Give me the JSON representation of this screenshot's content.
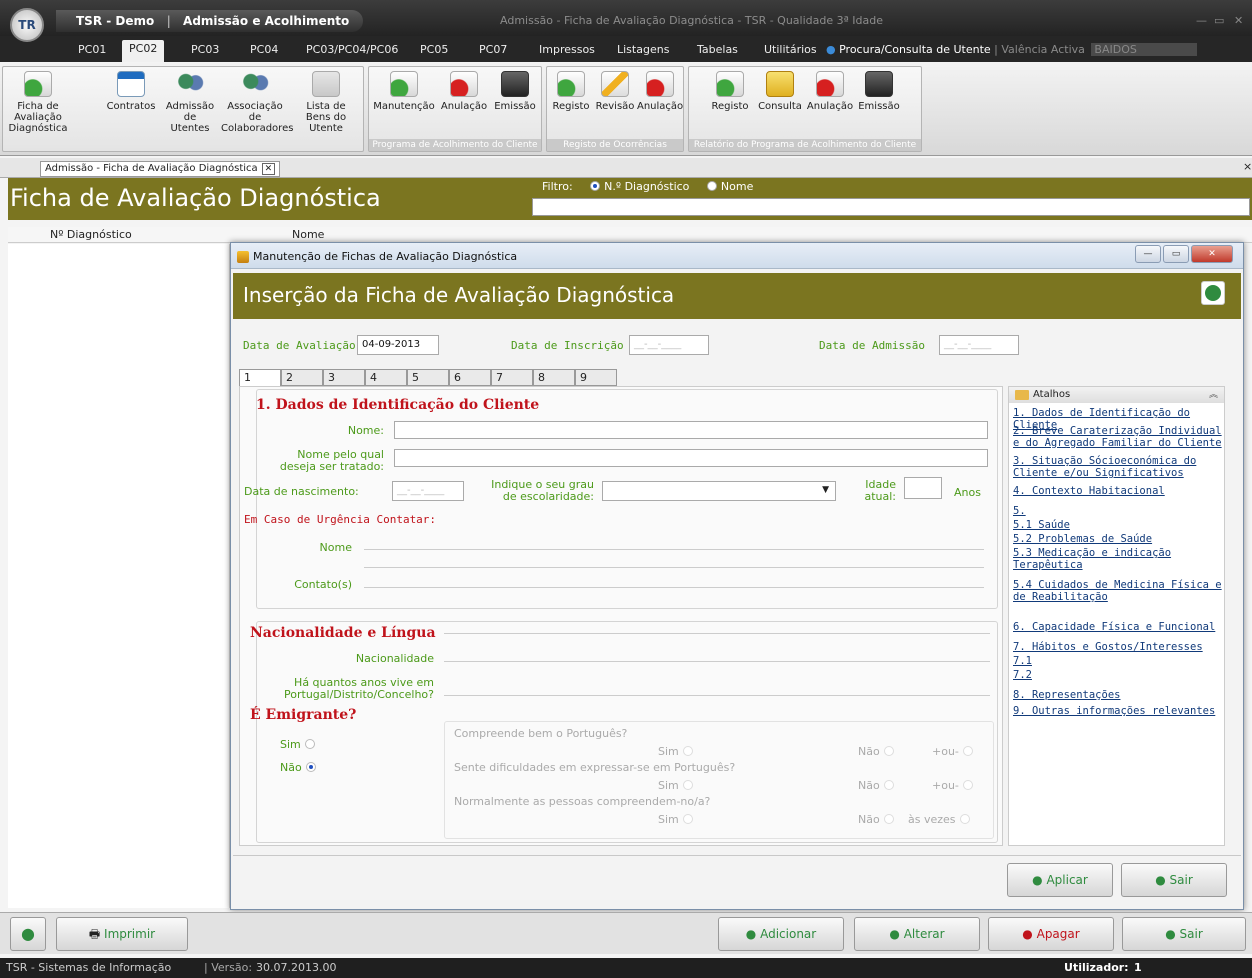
{
  "app": {
    "name": "TSR - Demo",
    "module": "Admissão e Acolhimento",
    "window_title": "Admissão - Ficha de Avaliação Diagnóstica - TSR - Qualidade 3ª Idade",
    "logo": "TR"
  },
  "tabs": [
    "PC01",
    "PC02",
    "PC03",
    "PC04",
    "PC03/PC04/PC06",
    "PC05",
    "PC07",
    "Impressos",
    "Listagens",
    "Tabelas",
    "Utilitários"
  ],
  "active_tab": "PC02",
  "search_tab": {
    "label": "Procura/Consulta de Utente",
    "valencia": "| Valência Activa",
    "value": "BAIDOS"
  },
  "ribbon": {
    "g1": [
      {
        "label": "Ficha de Avaliação Diagnóstica",
        "icon": "document-add-icon"
      },
      {
        "label": "Contratos",
        "icon": "contract-icon"
      },
      {
        "label": "Admissão de Utentes",
        "icon": "people-check-icon"
      },
      {
        "label": "Associação de Colaboradores",
        "icon": "people-icon"
      },
      {
        "label": "Lista de Bens do Utente",
        "icon": "list-icon"
      }
    ],
    "g2": {
      "label": "Programa de Acolhimento do Cliente",
      "buttons": [
        {
          "label": "Manutenção"
        },
        {
          "label": "Anulação"
        },
        {
          "label": "Emissão"
        }
      ]
    },
    "g3": {
      "label": "Registo de Ocorrências",
      "buttons": [
        {
          "label": "Registo"
        },
        {
          "label": "Revisão"
        },
        {
          "label": "Anulação"
        }
      ]
    },
    "g4": {
      "label": "Relatório do Programa de Acolhimento do Cliente",
      "buttons": [
        {
          "label": "Registo"
        },
        {
          "label": "Consulta"
        },
        {
          "label": "Anulação"
        },
        {
          "label": "Emissão"
        }
      ]
    }
  },
  "doc_tab": "Admissão - Ficha de Avaliação Diagnóstica",
  "page_title": "Ficha de Avaliação Diagnóstica",
  "filter": {
    "label": "Filtro:",
    "opt1": "N.º Diagnóstico",
    "opt2": "Nome",
    "selected": "N.º Diagnóstico"
  },
  "grid_headers": [
    "Nº Diagnóstico",
    "Nome"
  ],
  "modal": {
    "window_title": "Manutenção de Fichas de Avaliação Diagnóstica",
    "header": "Inserção da Ficha de Avaliação Diagnóstica",
    "data_avaliacao_label": "Data de Avaliação",
    "data_avaliacao": "04-09-2013",
    "data_inscricao_label": "Data de Inscrição",
    "data_admissao_label": "Data de Admissão",
    "empty_date": "__-__-____",
    "tabs": [
      "1",
      "2",
      "3",
      "4",
      "5",
      "6",
      "7",
      "8",
      "9"
    ],
    "s1_title": "1. Dados de Identificação do Cliente",
    "nome_label": "Nome:",
    "nome_tratado_label1": "Nome pelo qual",
    "nome_tratado_label2": "deseja ser tratado:",
    "nascimento_label": "Data de nascimento:",
    "escolaridade_label1": "Indique o seu grau",
    "escolaridade_label2": "de escolaridade:",
    "idade_label1": "Idade",
    "idade_label2": "atual:",
    "anos": "Anos",
    "urgencia_title": "Em Caso de Urgência Contatar:",
    "urg_nome": "Nome",
    "urg_contato": "Contato(s)",
    "nac_title": "Nacionalidade e Língua",
    "nacionalidade": "Nacionalidade",
    "ha_quantos1": "Há quantos anos vive em",
    "ha_quantos2": "Portugal/Distrito/Concelho?",
    "emigrante_title": "É Emigrante?",
    "sim": "Sim",
    "nao": "Não",
    "emigrante_selected": "Não",
    "q1": "Compreende bem o Português?",
    "q2": "Sente dificuldades em expressar-se em Português?",
    "q3": "Normalmente as pessoas compreendem-no/a?",
    "mais_ou_menos": "+ou-",
    "as_vezes": "às vezes",
    "shortcuts_title": "Atalhos",
    "shortcuts": [
      "1. Dados de Identificação do Cliente",
      "2. Breve Caraterização Individual e do Agregado Familiar do Cliente",
      "3. Situação Sócioeconómica do Cliente e/ou Significativos",
      "4. Contexto Habitacional",
      "5.",
      "5.1 Saúde",
      "5.2 Problemas de Saúde",
      "5.3 Medicação e indicação Terapêutica",
      "5.4 Cuidados de Medicina Física e de Reabilitação",
      "6. Capacidade Física e Funcional",
      "7. Hábitos e Gostos/Interesses",
      "7.1",
      "7.2",
      "8. Representações",
      "9. Outras informações relevantes"
    ],
    "aplicar": "Aplicar",
    "sair": "Sair"
  },
  "bottom": {
    "imprimir": "Imprimir",
    "adicionar": "Adicionar",
    "alterar": "Alterar",
    "apagar": "Apagar",
    "sair": "Sair"
  },
  "status": {
    "company": "TSR - Sistemas de Informação",
    "version_label": "| Versão:",
    "version": "30.07.2013.00",
    "user_label": "Utilizador:",
    "user": "1"
  }
}
